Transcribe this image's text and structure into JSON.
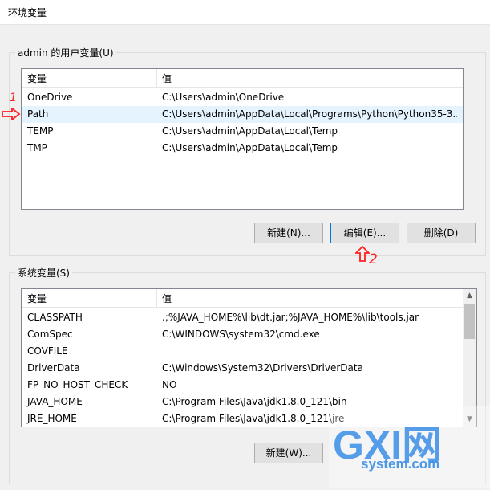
{
  "window": {
    "title": "环境变量"
  },
  "user_vars": {
    "group_label": "admin 的用户变量(U)",
    "headers": [
      "变量",
      "值"
    ],
    "rows": [
      {
        "name": "OneDrive",
        "value": "C:\\Users\\admin\\OneDrive"
      },
      {
        "name": "Path",
        "value": "C:\\Users\\admin\\AppData\\Local\\Programs\\Python\\Python35-3..."
      },
      {
        "name": "TEMP",
        "value": "C:\\Users\\admin\\AppData\\Local\\Temp"
      },
      {
        "name": "TMP",
        "value": "C:\\Users\\admin\\AppData\\Local\\Temp"
      }
    ],
    "selected_row": "Path",
    "buttons": {
      "new": "新建(N)...",
      "edit": "编辑(E)...",
      "delete": "删除(D)"
    }
  },
  "sys_vars": {
    "group_label": "系统变量(S)",
    "headers": [
      "变量",
      "值"
    ],
    "rows": [
      {
        "name": "CLASSPATH",
        "value": ".;%JAVA_HOME%\\lib\\dt.jar;%JAVA_HOME%\\lib\\tools.jar"
      },
      {
        "name": "ComSpec",
        "value": "C:\\WINDOWS\\system32\\cmd.exe"
      },
      {
        "name": "COVFILE",
        "value": ""
      },
      {
        "name": "DriverData",
        "value": "C:\\Windows\\System32\\Drivers\\DriverData"
      },
      {
        "name": "FP_NO_HOST_CHECK",
        "value": "NO"
      },
      {
        "name": "JAVA_HOME",
        "value": "C:\\Program Files\\Java\\jdk1.8.0_121\\bin"
      },
      {
        "name": "JRE_HOME",
        "value": "C:\\Program Files\\Java\\jdk1.8.0_121\\jre"
      }
    ],
    "buttons": {
      "new": "新建(W)..."
    }
  },
  "annotations": {
    "one": "1",
    "two": "2"
  },
  "watermark": {
    "logo": "GXI网",
    "site": "system.com"
  },
  "colors": {
    "annotation": "#ff2020",
    "selection": "#e5f3ff",
    "focus": "#0078d7"
  }
}
